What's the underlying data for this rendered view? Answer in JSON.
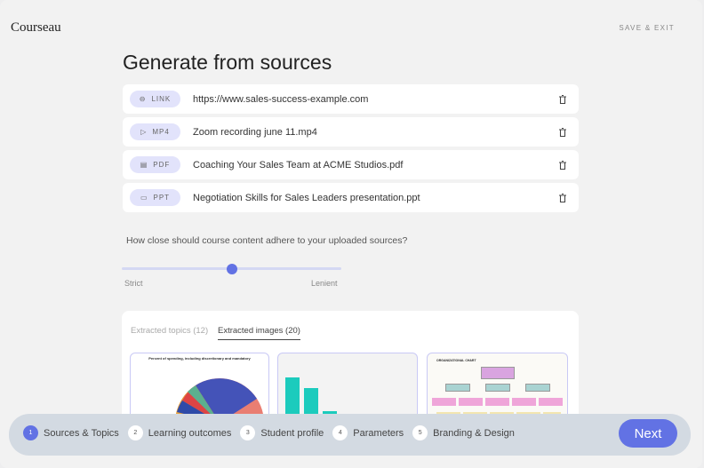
{
  "header": {
    "logo": "Courseau",
    "save_exit": "SAVE & EXIT"
  },
  "page_title": "Generate from sources",
  "sources": [
    {
      "type": "LINK",
      "icon": "link-icon",
      "name": "https://www.sales-success-example.com"
    },
    {
      "type": "MP4",
      "icon": "play-icon",
      "name": "Zoom recording june 11.mp4"
    },
    {
      "type": "PDF",
      "icon": "document-icon",
      "name": "Coaching Your Sales Team at ACME Studios.pdf"
    },
    {
      "type": "PPT",
      "icon": "presentation-icon",
      "name": "Negotiation Skills for Sales Leaders presentation.ppt"
    }
  ],
  "adherence": {
    "question": "How close should course content adhere to your uploaded sources?",
    "min_label": "Strict",
    "max_label": "Lenient",
    "value_percent": 50
  },
  "extracted": {
    "tabs": [
      {
        "label": "Extracted topics (12)",
        "active": false
      },
      {
        "label": "Extracted images (20)",
        "active": true
      }
    ],
    "images": [
      {
        "title": "Percent of spending, including discretionary and mandatory"
      },
      {
        "title": ""
      },
      {
        "title": "ORGANIZATIONAL CHART"
      }
    ]
  },
  "stepper": {
    "steps": [
      {
        "num": "1",
        "label": "Sources & Topics",
        "active": true
      },
      {
        "num": "2",
        "label": "Learning outcomes"
      },
      {
        "num": "3",
        "label": "Student profile"
      },
      {
        "num": "4",
        "label": "Parameters"
      },
      {
        "num": "5",
        "label": "Branding & Design"
      }
    ],
    "next_label": "Next"
  },
  "colors": {
    "accent": "#6272e4",
    "badge": "#e2e3fb"
  }
}
